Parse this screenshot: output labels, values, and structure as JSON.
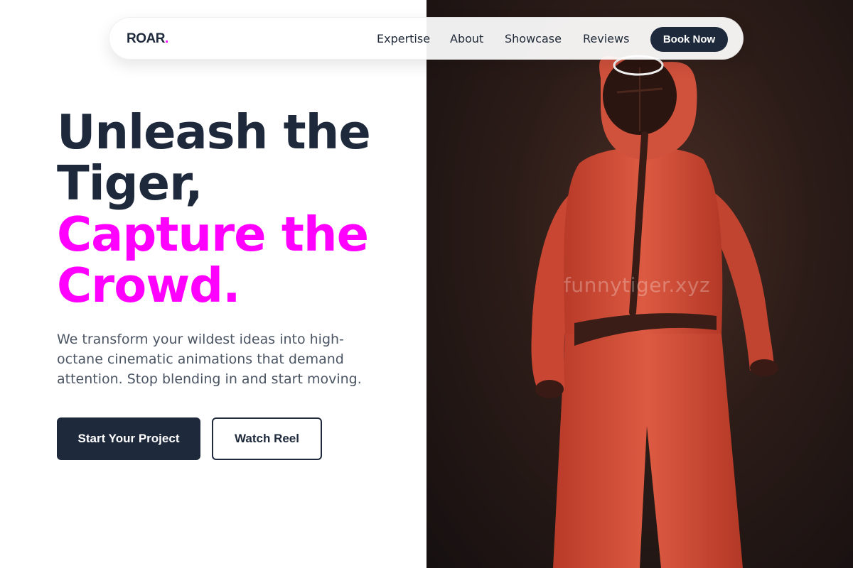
{
  "brand": {
    "name": "ROAR",
    "dot": "."
  },
  "nav": {
    "links": [
      "Expertise",
      "About",
      "Showcase",
      "Reviews"
    ],
    "cta": "Book Now"
  },
  "hero": {
    "headline_dark": [
      "Unleash the",
      "Tiger,"
    ],
    "headline_accent": [
      "Capture the",
      "Crowd."
    ],
    "description": "We transform your wildest ideas into high-octane cinematic animations that demand attention. Stop blending in and start moving.",
    "primary_button": "Start Your Project",
    "secondary_button": "Watch Reel",
    "image": {
      "icon": "red-jumpsuit-guard-figure",
      "watermark": "funnytiger.xyz"
    }
  },
  "colors": {
    "accent": "#ff00ff",
    "dark": "#1e293b",
    "muted": "#4b5563"
  }
}
